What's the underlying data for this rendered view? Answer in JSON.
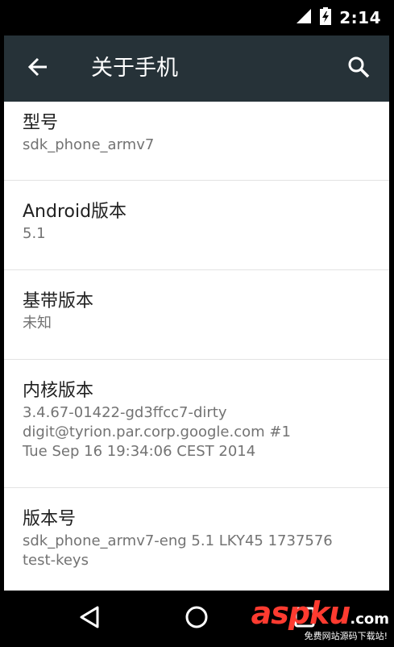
{
  "status_bar": {
    "time": "2:14",
    "icons": [
      "signal-icon",
      "battery-charging-icon"
    ]
  },
  "toolbar": {
    "title": "关于手机",
    "back_icon": "arrow-back-icon",
    "search_icon": "search-icon",
    "background_color": "#263238"
  },
  "items": [
    {
      "title": "型号",
      "summary": [
        "sdk_phone_armv7"
      ]
    },
    {
      "title": "Android版本",
      "summary": [
        "5.1"
      ]
    },
    {
      "title": "基带版本",
      "summary": [
        "未知"
      ]
    },
    {
      "title": "内核版本",
      "summary": [
        "3.4.67-01422-gd3ffcc7-dirty",
        "digit@tyrion.par.corp.google.com #1",
        "Tue Sep 16 19:34:06 CEST 2014"
      ]
    },
    {
      "title": "版本号",
      "summary": [
        "sdk_phone_armv7-eng 5.1 LKY45 1737576",
        "test-keys"
      ]
    }
  ],
  "nav_bar": {
    "buttons": [
      "back-triangle-icon",
      "home-circle-icon",
      "recents-square-icon"
    ]
  },
  "watermark": {
    "logo": "aspku",
    "domain": ".com",
    "tagline": "免费网站源码下载站!"
  }
}
